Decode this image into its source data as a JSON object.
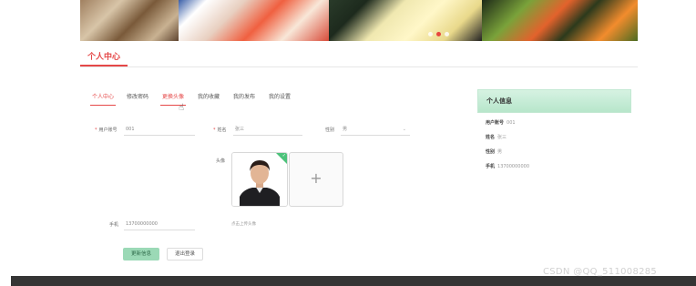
{
  "banner": {
    "slide_count": 3,
    "active_slide": 2
  },
  "section": {
    "title": "个人中心"
  },
  "tabs": [
    {
      "label": "个人中心",
      "active": true
    },
    {
      "label": "修改密码",
      "active": false
    },
    {
      "label": "更换头像",
      "active": false
    },
    {
      "label": "我的收藏",
      "active": false
    },
    {
      "label": "我的发布",
      "active": false
    },
    {
      "label": "我的设置",
      "active": false
    }
  ],
  "form": {
    "account_label": "用户账号",
    "account_value": "001",
    "name_label": "姓名",
    "name_value": "张三",
    "gender_label": "性别",
    "gender_value": "男",
    "avatar_label": "头像",
    "upload_plus": "+",
    "avatar_hint": "点击上传头像",
    "phone_label": "手机",
    "phone_value": "13700000000",
    "avatar_check": "✓"
  },
  "buttons": {
    "update": "更新信息",
    "logout": "退出登录"
  },
  "card": {
    "title": "个人信息",
    "rows": [
      {
        "key": "用户账号",
        "value": "001"
      },
      {
        "key": "姓名",
        "value": "张三"
      },
      {
        "key": "性别",
        "value": "男"
      },
      {
        "key": "手机",
        "value": "13700000000"
      }
    ]
  },
  "watermark": "CSDN @QQ_511008285",
  "colors": {
    "accent": "#e54848",
    "success": "#9bd9b6",
    "footer": "#353535"
  }
}
